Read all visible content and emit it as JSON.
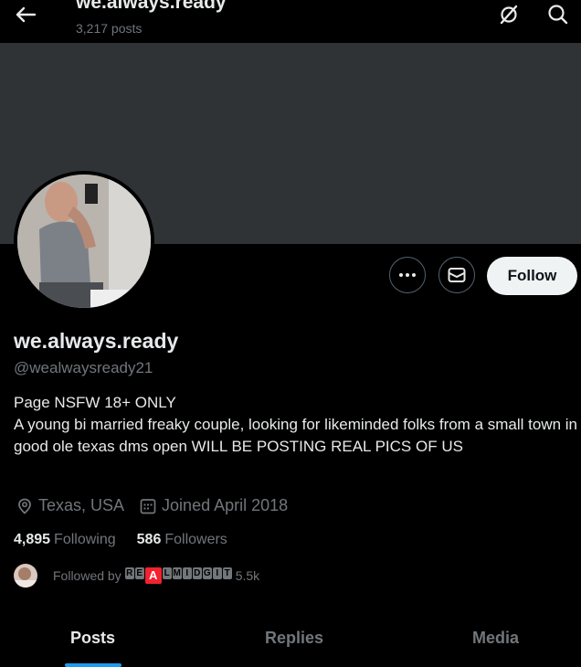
{
  "header": {
    "title": "we.always.ready",
    "posts_count": "3,217 posts"
  },
  "profile": {
    "display_name": "we.always.ready",
    "handle": "@wealwaysready21",
    "bio_line1": "Page NSFW 18+ ONLY",
    "bio_line2": "A young bi married freaky couple, looking for likeminded folks from a small town in good ole texas dms open WILL BE POSTING REAL PICS OF US",
    "location": "Texas, USA",
    "joined": "Joined April 2018",
    "following_count": "4,895",
    "following_label": "Following",
    "followers_count": "586",
    "followers_label": "Followers",
    "followed_by_prefix": "Followed by",
    "followed_by_suffix": "5.5k"
  },
  "actions": {
    "follow_label": "Follow"
  },
  "tabs": [
    {
      "label": "Posts",
      "active": true
    },
    {
      "label": "Replies",
      "active": false
    },
    {
      "label": "Media",
      "active": false
    }
  ],
  "colors": {
    "background": "#000000",
    "banner": "#2f3336",
    "text": "#e7e9ea",
    "muted": "#71767b",
    "accent": "#1d9bf0",
    "follow_bg": "#eff3f4"
  },
  "icons": [
    "back-arrow-icon",
    "grok-slash-icon",
    "search-icon",
    "more-icon",
    "mail-icon",
    "location-icon",
    "calendar-icon"
  ]
}
